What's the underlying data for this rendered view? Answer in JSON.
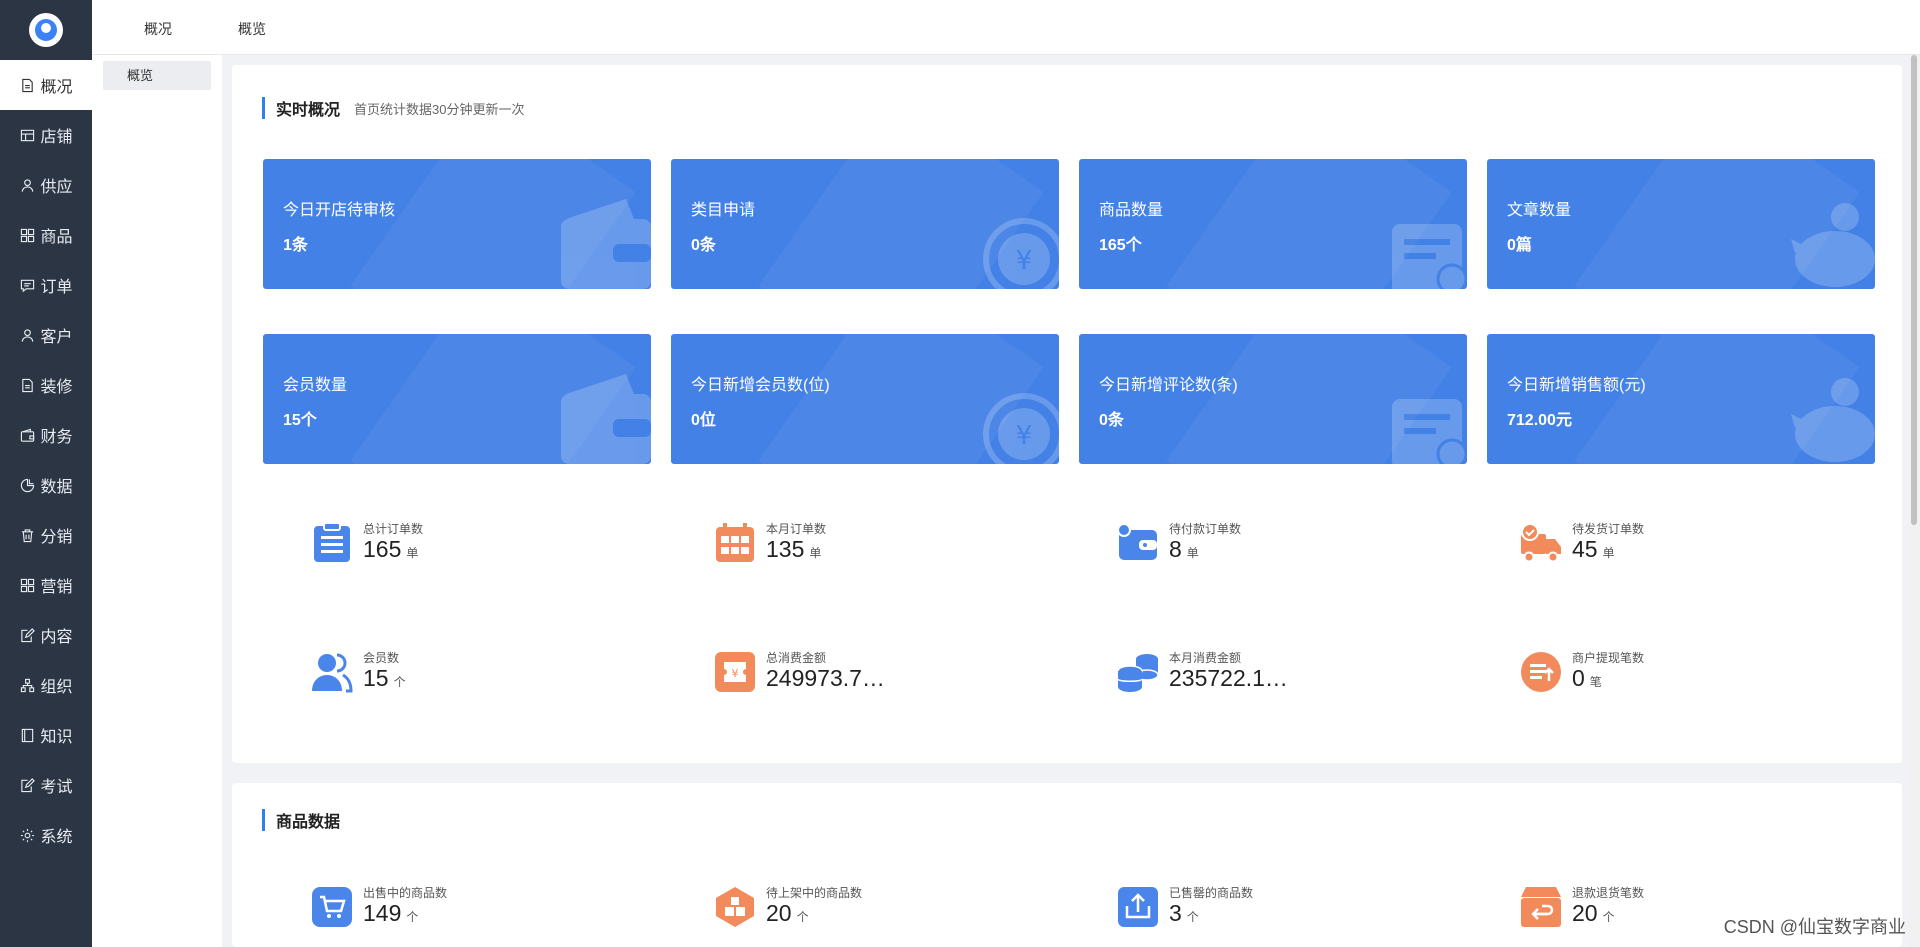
{
  "sidebar": {
    "items": [
      {
        "label": "概况",
        "icon": "document-icon"
      },
      {
        "label": "店铺",
        "icon": "store-icon"
      },
      {
        "label": "供应",
        "icon": "user-icon"
      },
      {
        "label": "商品",
        "icon": "grid-icon"
      },
      {
        "label": "订单",
        "icon": "message-icon"
      },
      {
        "label": "客户",
        "icon": "user-icon"
      },
      {
        "label": "装修",
        "icon": "document-icon"
      },
      {
        "label": "财务",
        "icon": "wallet-icon"
      },
      {
        "label": "数据",
        "icon": "chart-icon"
      },
      {
        "label": "分销",
        "icon": "trash-icon"
      },
      {
        "label": "营销",
        "icon": "grid-icon"
      },
      {
        "label": "内容",
        "icon": "edit-icon"
      },
      {
        "label": "组织",
        "icon": "org-icon"
      },
      {
        "label": "知识",
        "icon": "book-icon"
      },
      {
        "label": "考试",
        "icon": "edit-icon"
      },
      {
        "label": "系统",
        "icon": "gear-icon"
      }
    ]
  },
  "header": {
    "crumbs": [
      "概况",
      "概览"
    ]
  },
  "subnav": {
    "item": "概览"
  },
  "realtime": {
    "title": "实时概况",
    "subtitle": "首页统计数据30分钟更新一次",
    "cards": [
      {
        "label": "今日开店待审核",
        "value": "1条"
      },
      {
        "label": "类目申请",
        "value": "0条"
      },
      {
        "label": "商品数量",
        "value": "165个"
      },
      {
        "label": "文章数量",
        "value": "0篇"
      },
      {
        "label": "会员数量",
        "value": "15个"
      },
      {
        "label": "今日新增会员数(位)",
        "value": "0位"
      },
      {
        "label": "今日新增评论数(条)",
        "value": "0条"
      },
      {
        "label": "今日新增销售额(元)",
        "value": "712.00元"
      }
    ],
    "metrics": [
      {
        "label": "总计订单数",
        "value": "165",
        "unit": "单",
        "color": "#4a85ea"
      },
      {
        "label": "本月订单数",
        "value": "135",
        "unit": "单",
        "color": "#f28a5b"
      },
      {
        "label": "待付款订单数",
        "value": "8",
        "unit": "单",
        "color": "#4a85ea"
      },
      {
        "label": "待发货订单数",
        "value": "45",
        "unit": "单",
        "color": "#f28a5b"
      },
      {
        "label": "会员数",
        "value": "15",
        "unit": "个",
        "color": "#4a85ea"
      },
      {
        "label": "总消费金额",
        "value": "249973.7…",
        "unit": "",
        "color": "#f28a5b"
      },
      {
        "label": "本月消费金额",
        "value": "235722.1…",
        "unit": "",
        "color": "#4a85ea"
      },
      {
        "label": "商户提现笔数",
        "value": "0",
        "unit": "笔",
        "color": "#f28a5b"
      }
    ]
  },
  "goods": {
    "title": "商品数据",
    "metrics": [
      {
        "label": "出售中的商品数",
        "value": "149",
        "unit": "个"
      },
      {
        "label": "待上架中的商品数",
        "value": "20",
        "unit": "个"
      },
      {
        "label": "已售罄的商品数",
        "value": "3",
        "unit": "个"
      },
      {
        "label": "退款退货笔数",
        "value": "20",
        "unit": "个"
      }
    ]
  },
  "watermark": "CSDN @仙宝数字商业"
}
